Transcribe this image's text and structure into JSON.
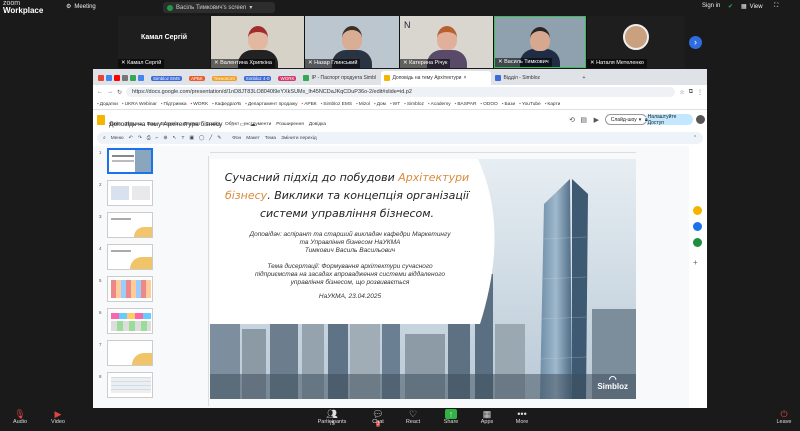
{
  "zoom": {
    "app_name_line1": "zoom",
    "app_name_line2": "Workplace",
    "meeting_label": "Meeting",
    "share_label": "Васіль Тимкович's screen",
    "sign_in": "Sign in",
    "view_label": "View"
  },
  "participants": [
    {
      "name": "Камал Сергій"
    },
    {
      "name": "Валентина Хрипкіна"
    },
    {
      "name": "Назар Глинський"
    },
    {
      "name": "Катерина Річук"
    },
    {
      "name": "Василь Тимкович"
    },
    {
      "name": "Наталя Метеленко"
    }
  ],
  "browser": {
    "tabs": [
      {
        "label": "Simbloz EMS",
        "color": "#3b6bd6"
      },
      {
        "label": "АРБК",
        "color": "#e65c2b"
      },
      {
        "label": "Технології",
        "color": "#f0a020"
      },
      {
        "label": "Simbloz 4-0",
        "color": "#3b6bd6"
      },
      {
        "label": "WORK",
        "color": "#d23c6b"
      },
      {
        "label": "IP - Паспорт продукта Simbl",
        "color": "#34a853"
      },
      {
        "label": "Доповідь на тему Архітектури",
        "color": "#f4b400"
      },
      {
        "label": "Відділ - Simbloz",
        "color": "#3b6bd6"
      }
    ],
    "url": "https://docs.google.com/presentation/d/1nD8JT83LO8040l9eYXkSUMx_lh45NCDaJKqCDuP36o-2/edit#slide=id.p2",
    "bookmarks": [
      {
        "label": "Додатки"
      },
      {
        "label": "UKRA Webinar"
      },
      {
        "label": "Підтримка"
      },
      {
        "label": "WORK",
        "tag": "#d23c6b"
      },
      {
        "label": "КафедраУБ"
      },
      {
        "label": "Департамент продажу"
      },
      {
        "label": "АРБК",
        "tag": "#e65c2b"
      },
      {
        "label": "Simbloz EMS"
      },
      {
        "label": "Mizol"
      },
      {
        "label": "Дом"
      },
      {
        "label": "WT"
      },
      {
        "label": "Simbloz"
      },
      {
        "label": "Academy"
      },
      {
        "label": "BASPAR"
      },
      {
        "label": "ODOO"
      },
      {
        "label": "Бази"
      },
      {
        "label": "YouTube"
      },
      {
        "label": "Карти"
      }
    ]
  },
  "slides_app": {
    "doc_title": "Доповідь на тему Архітектура бізнесу",
    "menus": [
      "Файл",
      "Правка",
      "Вид",
      "Вставка",
      "Формат",
      "Слайд",
      "Об'єкт",
      "Інструменти",
      "Розширення",
      "Довідка"
    ],
    "slideshow_label": "Слайд-шоу",
    "share_label": "Налаштуйте Доступ",
    "toolbar": [
      "Меню",
      "Фон",
      "Макет",
      "Тема",
      "Змінити перехід"
    ]
  },
  "slide": {
    "title_part1": "Сучасний підхід до побудови ",
    "title_highlight": "Архітектури бізнесу",
    "title_part2": ". Виклики та концепція організації системи управління бізнесом.",
    "author_line1": "Доповідач: аспірант та старший викладач кафедри Маркетингу",
    "author_line2": "та Управління бізнесом НаУКМА",
    "author_line3": "Тимкович Василь Васильович",
    "thesis_line1": "Тема дисертації: Формування архітектури сучасного",
    "thesis_line2": "підприємства на засадах впровадження системи віддаленого",
    "thesis_line3": "управління бізнесом, що розвивається",
    "date": "НаУКМА, 23.04.2025",
    "logo": "Simbloz"
  },
  "slide_numbers": [
    "1",
    "2",
    "3",
    "4",
    "5",
    "6",
    "7",
    "8"
  ],
  "bottom_bar": {
    "audio": "Audio",
    "video": "Video",
    "participants": "Participants",
    "participants_count": "75",
    "chat": "Chat",
    "chat_badge": "3",
    "react": "React",
    "share": "Share",
    "apps": "Apps",
    "more": "More",
    "leave": "Leave"
  }
}
